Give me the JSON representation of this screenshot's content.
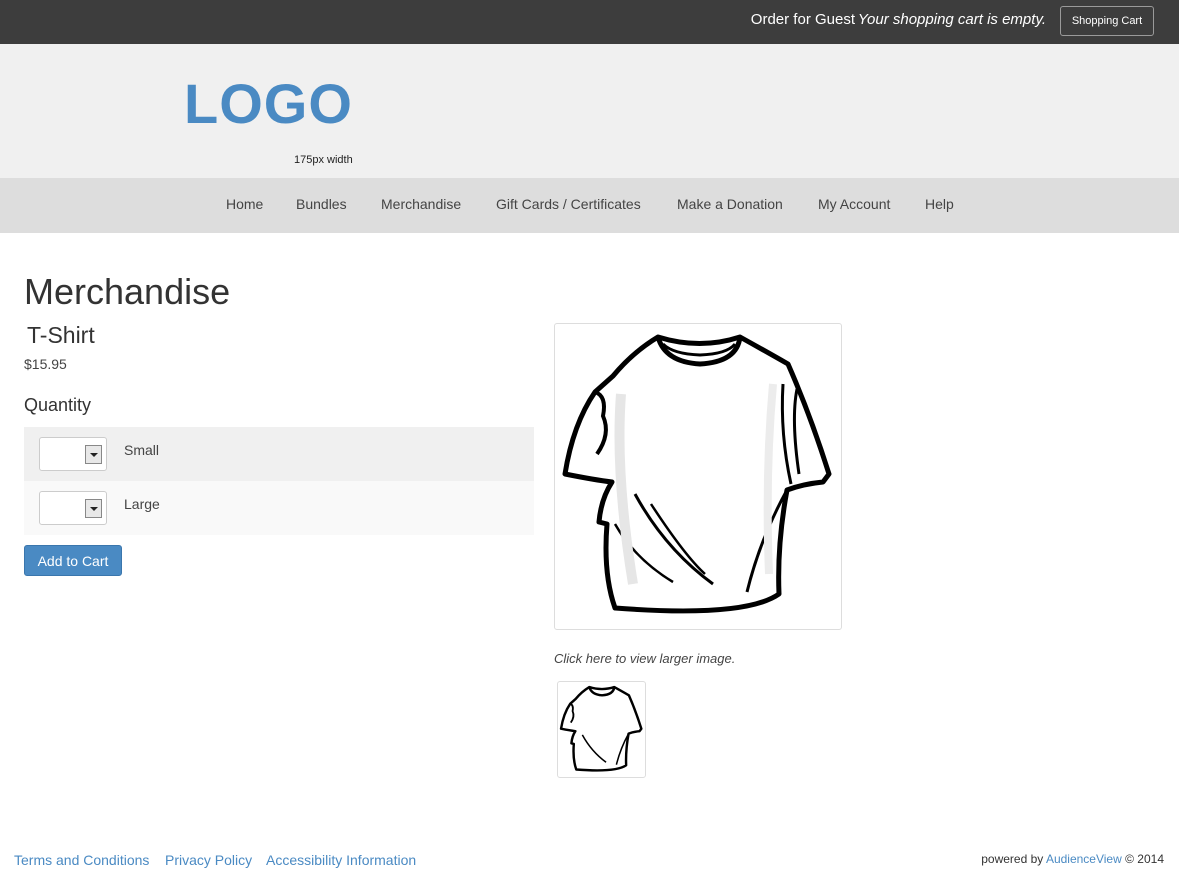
{
  "topbar": {
    "order_text": "Order for Guest",
    "cart_status": "Your shopping cart is empty.",
    "cart_button": "Shopping Cart"
  },
  "header": {
    "logo_text": "LOGO",
    "logo_note": "175px width"
  },
  "nav": {
    "items": [
      {
        "label": "Home"
      },
      {
        "label": "Bundles"
      },
      {
        "label": "Merchandise"
      },
      {
        "label": "Gift Cards / Certificates"
      },
      {
        "label": "Make a Donation"
      },
      {
        "label": "My Account"
      },
      {
        "label": "Help"
      }
    ]
  },
  "main": {
    "page_title": "Merchandise",
    "product_name": "T-Shirt",
    "price": "$15.95",
    "quantity_heading": "Quantity",
    "sizes": [
      {
        "label": "Small",
        "value": ""
      },
      {
        "label": "Large",
        "value": ""
      }
    ],
    "add_button": "Add to Cart",
    "image_caption": "Click here to view larger image.",
    "image_icon": "tshirt-image"
  },
  "footer": {
    "links": [
      {
        "label": "Terms and Conditions"
      },
      {
        "label": "Privacy Policy"
      },
      {
        "label": "Accessibility Information"
      }
    ],
    "powered_prefix": "powered by",
    "powered_brand": "AudienceView",
    "powered_suffix": "© 2014"
  },
  "colors": {
    "accent": "#4a8ac3",
    "topbar_bg": "#3d3d3d",
    "header_bg": "#f0f0f0",
    "nav_bg": "#dddddd"
  }
}
